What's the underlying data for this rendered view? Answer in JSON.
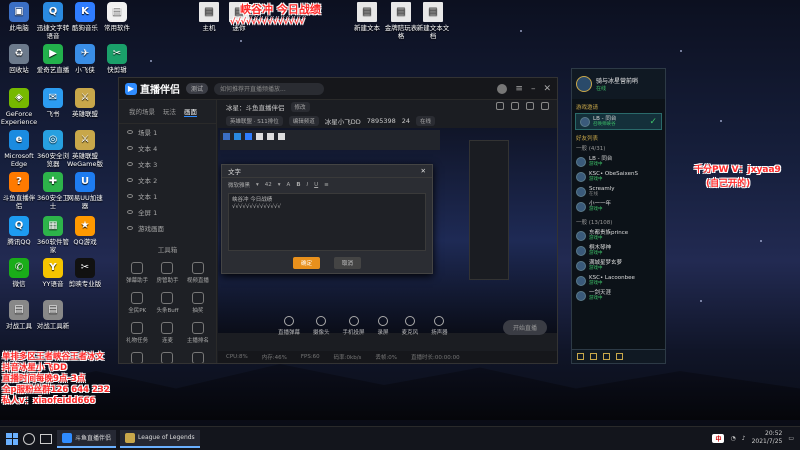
{
  "overlay": {
    "top_banner": "峡谷冲 今日战绩",
    "top_checks": "√√√√√√√√√√√√√√",
    "pw_line1": "千分PW V：jxyaa9",
    "pw_line2": "(自己开的)",
    "info_lines": [
      "单排多区王者峡谷王者冰文",
      "抖音冰星小飞DD",
      "直播时间每晚9点-3点",
      "全p服粉丝群126 644 232",
      "私人v：xiaofeidd666"
    ]
  },
  "desktop_icons": [
    {
      "label": "此电脑",
      "color": "#3b6fc4",
      "glyph": "▣"
    },
    {
      "label": "迅捷文字转语音",
      "color": "#2a8ae0",
      "glyph": "Q"
    },
    {
      "label": "酷狗音乐",
      "color": "#2f7dff",
      "glyph": "K"
    },
    {
      "label": "常用软件",
      "color": "#f1f1f1",
      "glyph": "▤"
    },
    {
      "label": "回收站",
      "color": "#6c7a8c",
      "glyph": "♻"
    },
    {
      "label": "爱奇艺直播",
      "color": "#22b14c",
      "glyph": "▶"
    },
    {
      "label": "小飞侠",
      "color": "#3a8ee6",
      "glyph": "✈"
    },
    {
      "label": "快剪辑",
      "color": "#1aa06a",
      "glyph": "✂"
    },
    {
      "label": "GeForce Experience",
      "color": "#76b900",
      "glyph": "◈"
    },
    {
      "label": "飞书",
      "color": "#2c9cf0",
      "glyph": "✉"
    },
    {
      "label": "英雄联盟",
      "color": "#c8a74a",
      "glyph": "⚔"
    },
    {
      "label": "Microsoft Edge",
      "color": "#1b8be0",
      "glyph": "e"
    },
    {
      "label": "360安全浏览器",
      "color": "#27a0e0",
      "glyph": "◎"
    },
    {
      "label": "英雄联盟WeGame版",
      "color": "#c8a74a",
      "glyph": "⚔"
    },
    {
      "label": "斗鱼直播伴侣",
      "color": "#ff7a00",
      "glyph": "?"
    },
    {
      "label": "360安全卫士",
      "color": "#2db34a",
      "glyph": "✚"
    },
    {
      "label": "网易UU加速器",
      "color": "#1e7cf0",
      "glyph": "U"
    },
    {
      "label": "腾讯QQ",
      "color": "#1d9bf0",
      "glyph": "Q"
    },
    {
      "label": "360软件管家",
      "color": "#2db34a",
      "glyph": "▦"
    },
    {
      "label": "QQ游戏",
      "color": "#ff9800",
      "glyph": "★"
    },
    {
      "label": "微信",
      "color": "#1aad19",
      "glyph": "✆"
    },
    {
      "label": "YY语音",
      "color": "#f5c400",
      "glyph": "Y"
    },
    {
      "label": "剪映专业版",
      "color": "#111111",
      "glyph": "✂"
    },
    {
      "label": "对战工具",
      "color": "#888888",
      "glyph": "▤"
    },
    {
      "label": "对战工具新",
      "color": "#888888",
      "glyph": "▤"
    }
  ],
  "top_files": [
    {
      "label": "主机"
    },
    {
      "label": "迷你"
    },
    {
      "label": "新建文本"
    },
    {
      "label": "金牌陪玩表格"
    },
    {
      "label": "新建文本文档"
    }
  ],
  "app": {
    "logo": "直播伴侣",
    "badge": "测试",
    "search_placeholder": "如何推荐开直播频播放...",
    "side_tabs": [
      "我的场景",
      "玩法",
      "画面"
    ],
    "layers": [
      "场景 1",
      "文本 4",
      "文本 3",
      "文本 2",
      "文本 1",
      "全屏 1",
      "游戏画面"
    ],
    "tools_title": "工具箱",
    "tools": [
      "弹幕助手",
      "房管助手",
      "视频直播",
      "全民PK",
      "头条Buff",
      "抽奖",
      "礼物任务",
      "连麦",
      "主播排名",
      "更多",
      "下载",
      "设置"
    ],
    "stream_title": "冰星：斗鱼直播伴侣",
    "edit_label": "修改",
    "chip_left": "英雄联盟 · S11排位",
    "chip_mid": "编辑频道",
    "chip_right": "在线",
    "stat_a": "冰星小飞DD",
    "stat_b": "7895398",
    "stat_c": "24",
    "dialog": {
      "title": "文字",
      "font": "微软雅黑",
      "size": "42",
      "text_line1": "峡谷冲 今日战绩",
      "text_line2": "√√√√√√√√√√√√√√",
      "ok": "确定",
      "cancel": "取消"
    },
    "bottom_tools": [
      "直播弹幕",
      "摄像头",
      "手机投屏",
      "录屏",
      "麦克风",
      "扬声器"
    ],
    "go_live": "开始直播",
    "status": [
      "CPU:8%",
      "内存:46%",
      "FPS:60",
      "码率:0kb/s",
      "丢帧:0%",
      "直播时长:00:00:00"
    ]
  },
  "friends": {
    "user_name": "骑与冰星营前哨",
    "user_status": "在线",
    "section_invite": "游戏邀请",
    "invite_name": "LB - 同台",
    "invite_sub": "召唤师峡谷",
    "section_friends": "好友列表",
    "group1": "一般 (4/31)",
    "group2": "一般 (13/108)",
    "list": [
      {
        "name": "LB - 同台",
        "status": "游戏中",
        "on": true
      },
      {
        "name": "KSC• ObeSaixenS",
        "status": "游戏中",
        "on": true
      },
      {
        "name": "Screamly",
        "status": "在线",
        "on": false
      },
      {
        "name": "小一一年",
        "status": "游戏中",
        "on": true
      },
      {
        "name": "东都贵族prince",
        "status": "游戏中",
        "on": true
      },
      {
        "name": "桐木琴神",
        "status": "游戏中",
        "on": true
      },
      {
        "name": "满城星梦玄萝",
        "status": "游戏中",
        "on": true
      },
      {
        "name": "KSC• Lacoonbee",
        "status": "游戏中",
        "on": true
      },
      {
        "name": "一剑天涯",
        "status": "游戏中",
        "on": true
      }
    ]
  },
  "taskbar": {
    "apps": [
      {
        "label": "斗鱼直播伴侣",
        "color": "#2f8cff"
      },
      {
        "label": "League of Legends",
        "color": "#c8a74a"
      }
    ],
    "ime": "中",
    "time": "20:52",
    "date": "2021/7/25"
  }
}
